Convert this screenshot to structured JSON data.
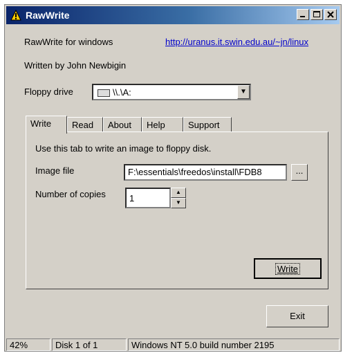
{
  "window": {
    "title": "RawWrite"
  },
  "header": {
    "app_name": "RawWrite for windows",
    "url": "http://uranus.it.swin.edu.au/~jn/linux",
    "author": "Written by John Newbigin",
    "floppy_label": "Floppy drive",
    "floppy_value": "\\\\.\\A:"
  },
  "tabs": [
    "Write",
    "Read",
    "About",
    "Help",
    "Support"
  ],
  "write_tab": {
    "description": "Use this tab to write an image to floppy disk.",
    "image_label": "Image file",
    "image_value": "F:\\essentials\\freedos\\install\\FDB8",
    "browse_label": "...",
    "copies_label": "Number of copies",
    "copies_value": "1",
    "write_button": "Write"
  },
  "exit_button": "Exit",
  "status": {
    "progress": "42%",
    "disk": "Disk 1 of 1",
    "os": "Windows NT 5.0 build number 2195"
  },
  "icons": {
    "app": "warning-triangle-icon",
    "minimize": "minimize-icon",
    "maximize": "maximize-icon",
    "close": "close-icon",
    "drive": "floppy-drive-icon",
    "dropdown": "chevron-down-icon",
    "spin_up": "arrow-up-icon",
    "spin_down": "arrow-down-icon"
  }
}
